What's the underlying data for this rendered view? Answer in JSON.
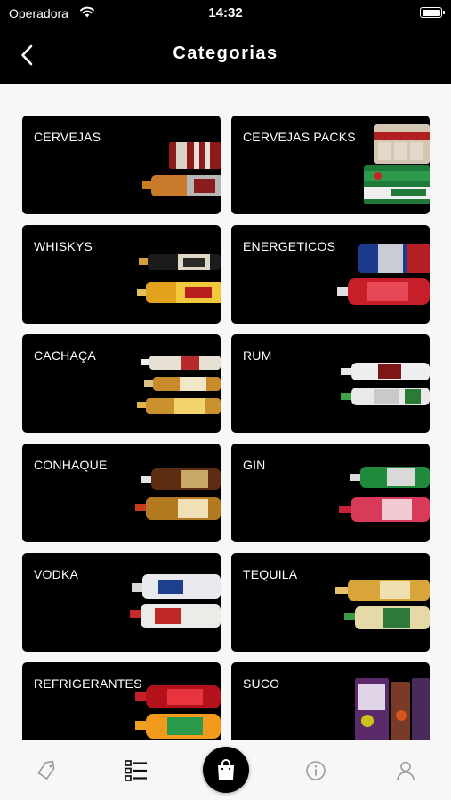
{
  "status_bar": {
    "carrier": "Operadora",
    "time": "14:32"
  },
  "header": {
    "title": "Categorias"
  },
  "categories": [
    {
      "label": "CERVEJAS",
      "art": "cans"
    },
    {
      "label": "CERVEJAS PACKS",
      "art": "packs"
    },
    {
      "label": "WHISKYS",
      "art": "bottles-whisky"
    },
    {
      "label": "ENERGETICOS",
      "art": "energy"
    },
    {
      "label": "CACHAÇA",
      "art": "bottles-cachaca"
    },
    {
      "label": "RUM",
      "art": "bottles-rum"
    },
    {
      "label": "CONHAQUE",
      "art": "bottles-conhaque"
    },
    {
      "label": "GIN",
      "art": "bottles-gin"
    },
    {
      "label": "VODKA",
      "art": "bottles-vodka"
    },
    {
      "label": "TEQUILA",
      "art": "bottles-tequila"
    },
    {
      "label": "REFRIGERANTES",
      "art": "soda"
    },
    {
      "label": "SUCO",
      "art": "juice"
    }
  ],
  "tab_bar": {
    "items": [
      {
        "name": "promos",
        "icon": "tag-icon"
      },
      {
        "name": "categories",
        "icon": "list-icon",
        "active": true
      },
      {
        "name": "cart",
        "icon": "shopping-bag-icon"
      },
      {
        "name": "info",
        "icon": "info-icon"
      },
      {
        "name": "profile",
        "icon": "user-icon"
      }
    ]
  },
  "colors": {
    "background": "#f7f7f7",
    "bar": "#000000",
    "card": "#000000",
    "text_on_dark": "#ffffff",
    "inactive_icon": "#9a9a9a"
  }
}
